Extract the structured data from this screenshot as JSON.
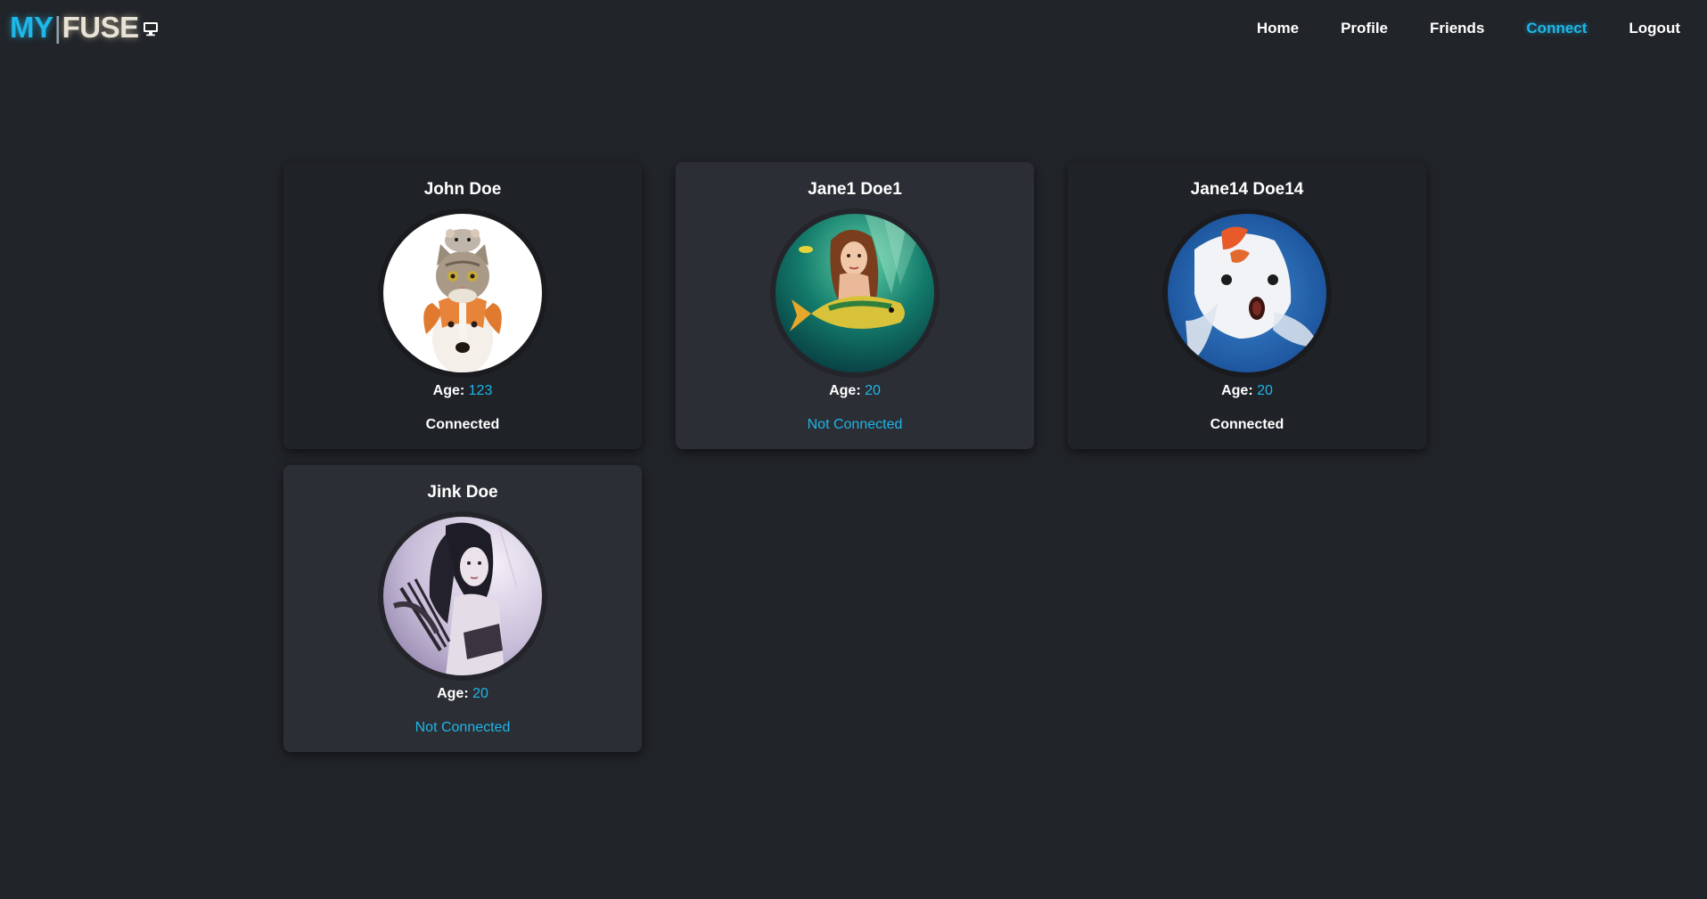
{
  "brand": {
    "part1": "MY",
    "separator": "|",
    "part2": "FUSE",
    "icon": "monitor-icon"
  },
  "nav": {
    "items": [
      {
        "label": "Home"
      },
      {
        "label": "Profile"
      },
      {
        "label": "Friends"
      },
      {
        "label": "Connect",
        "active": true
      },
      {
        "label": "Logout"
      }
    ]
  },
  "users": [
    {
      "name": "John Doe",
      "age_label": "Age:",
      "age": "123",
      "status": "Connected",
      "avatar": "cat-hamster-dog-avatar"
    },
    {
      "name": "Jane1 Doe1",
      "age_label": "Age:",
      "age": "20",
      "status": "Not Connected",
      "avatar": "mermaid-fish-avatar"
    },
    {
      "name": "Jane14 Doe14",
      "age_label": "Age:",
      "age": "20",
      "status": "Connected",
      "avatar": "koi-fish-avatar"
    },
    {
      "name": "Jink Doe",
      "age_label": "Age:",
      "age": "20",
      "status": "Not Connected",
      "avatar": "archer-woman-avatar"
    }
  ],
  "colors": {
    "background": "#212429",
    "accent": "#1fb6e8",
    "card_dark": "#1f2227",
    "card_light": "#2b2e34"
  }
}
